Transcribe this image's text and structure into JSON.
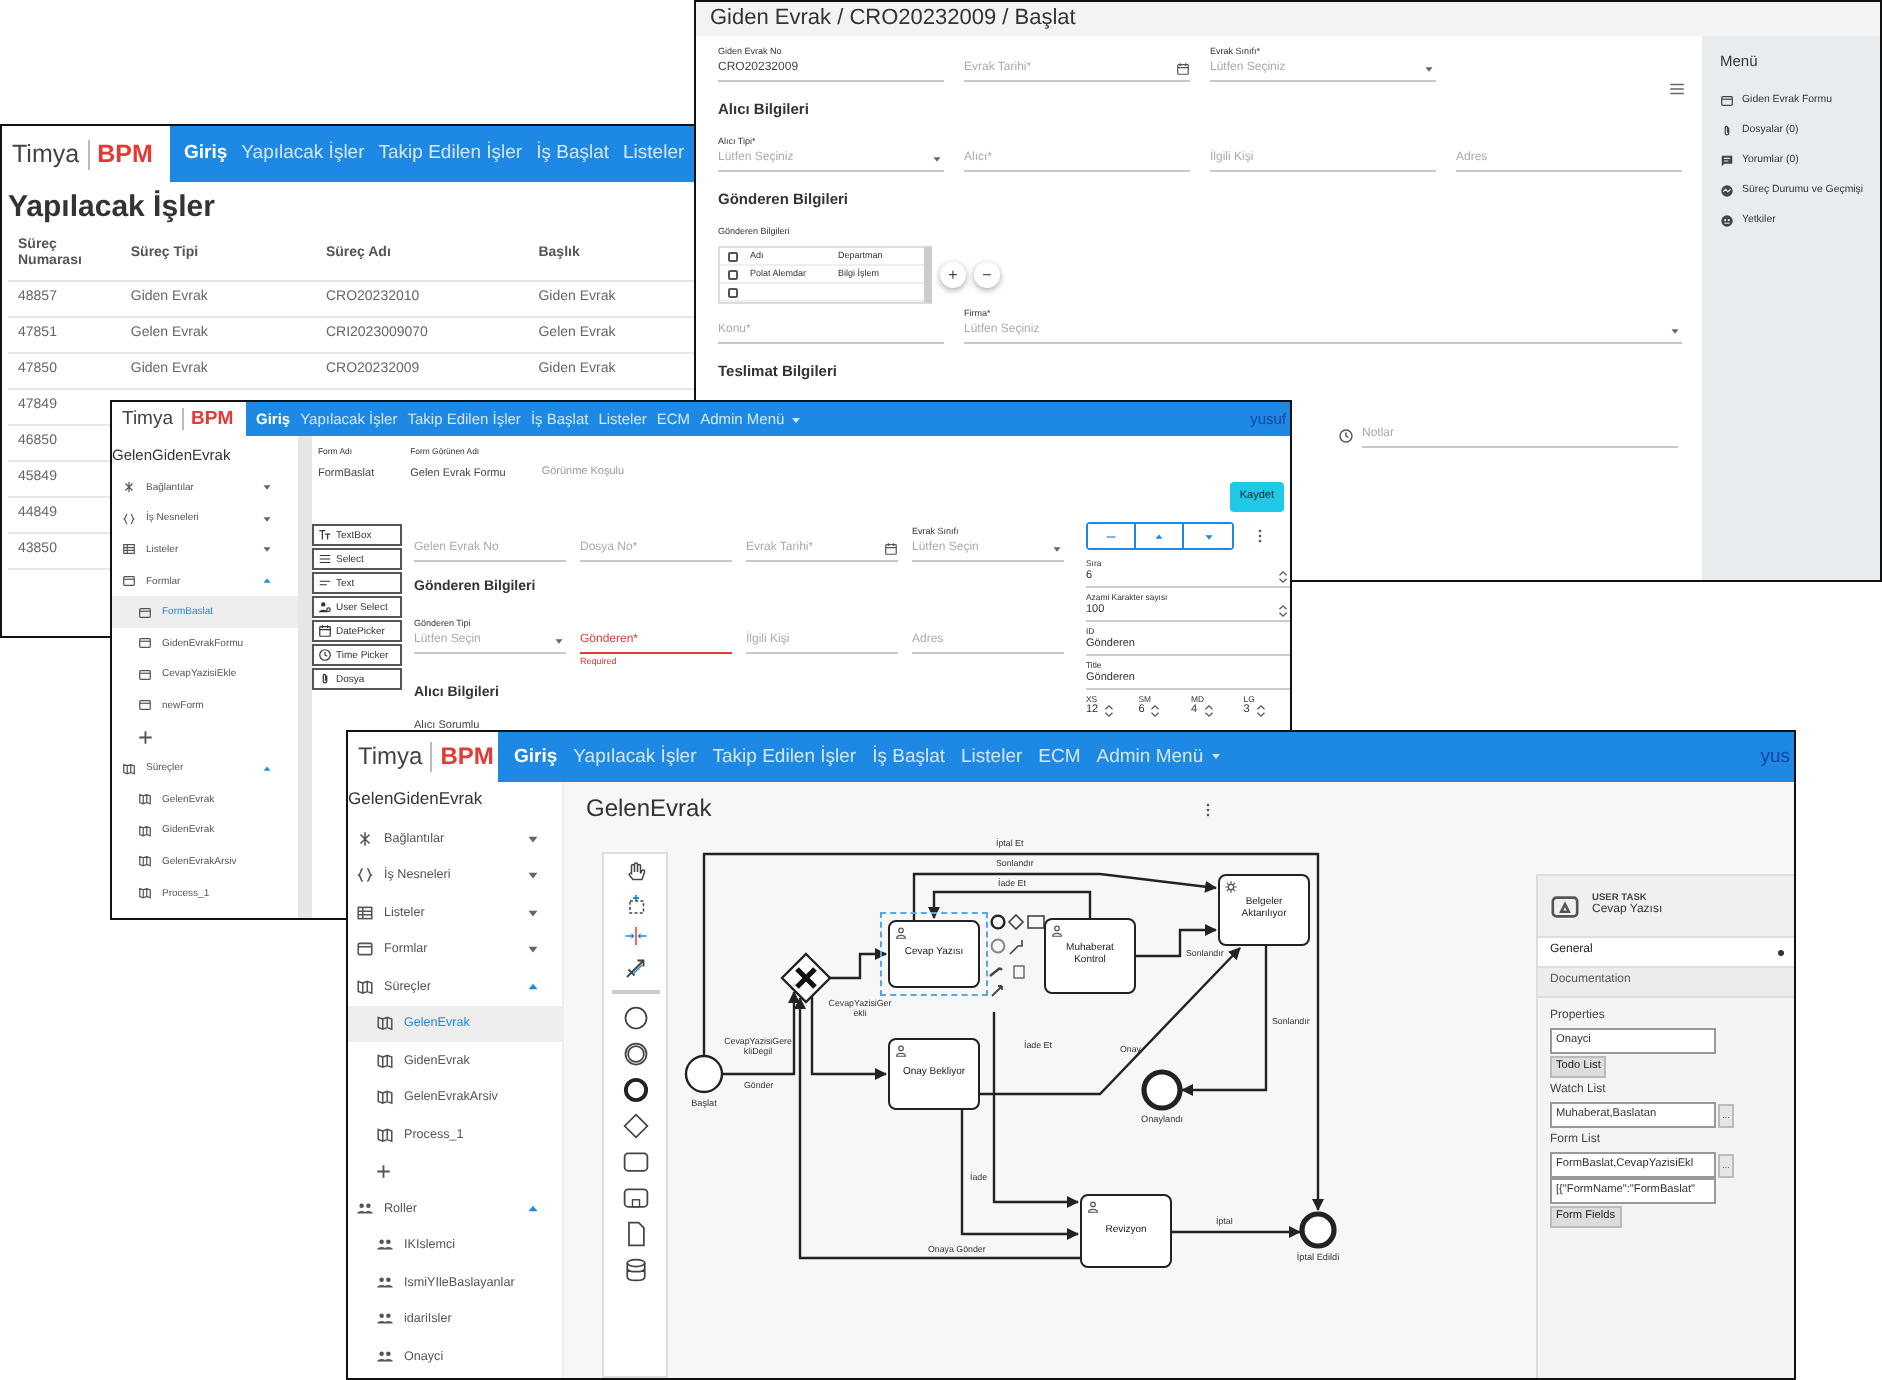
{
  "list_window": {
    "logo": {
      "text": "Timya",
      "accent": "BPM"
    },
    "nav": [
      {
        "label": "Giriş",
        "selected": true
      },
      {
        "label": "Yapılacak İşler",
        "selected": false
      },
      {
        "label": "Takip Edilen İşler",
        "selected": false
      },
      {
        "label": "İş Başlat",
        "selected": false
      },
      {
        "label": "Listeler",
        "selected": false
      }
    ],
    "title": "Yapılacak İşler",
    "columns": [
      "Süreç Numarası",
      "Süreç Tipi",
      "Süreç Adı",
      "Başlık"
    ],
    "rows": [
      [
        "48857",
        "Giden Evrak",
        "CRO20232010",
        "Giden Evrak"
      ],
      [
        "47851",
        "Gelen Evrak",
        "CRI2023009070",
        "Gelen Evrak"
      ],
      [
        "47850",
        "Giden Evrak",
        "CRO20232009",
        "Giden Evrak"
      ],
      [
        "47849"
      ],
      [
        "46850"
      ],
      [
        "45849"
      ],
      [
        "44849"
      ],
      [
        "43850"
      ]
    ]
  },
  "form_window": {
    "title": "Giden Evrak / CRO20232009 / Başlat",
    "blocks": [
      {
        "kind": "fields",
        "fields": [
          {
            "kind": "text",
            "label": "Giden Evrak No",
            "value": "CRO20232009"
          },
          {
            "kind": "date",
            "placeholder": "Evrak Tarihi*"
          },
          {
            "kind": "select",
            "label": "Evrak Sınıfı*",
            "placeholder": "Lütfen Seçiniz"
          }
        ]
      },
      {
        "kind": "heading",
        "text": "Alıcı Bilgileri"
      },
      {
        "kind": "fields",
        "fields": [
          {
            "kind": "select",
            "label": "Alıcı Tipi*",
            "placeholder": "Lütfen Seçiniz"
          },
          {
            "kind": "text",
            "placeholder": "Alıcı*"
          },
          {
            "kind": "text",
            "placeholder": "İlgili Kişi"
          },
          {
            "kind": "text",
            "placeholder": "Adres"
          }
        ]
      },
      {
        "kind": "heading",
        "text": "Gönderen Bilgileri"
      },
      {
        "kind": "grid",
        "label": "Gönderen Bilgileri",
        "header_checked": false,
        "columns": [
          "Adı",
          "Departman"
        ],
        "rows": [
          {
            "cells": [
              "Polat Alemdar",
              "Bilgi İşlem"
            ],
            "checked": false
          },
          {
            "cells": [],
            "checked": false
          }
        ],
        "actions": [
          "+",
          "−"
        ]
      },
      {
        "kind": "fields",
        "fields": [
          {
            "kind": "text",
            "placeholder": "Konu*"
          },
          {
            "kind": "select",
            "label": "Firma*",
            "placeholder": "Lütfen Seçiniz",
            "wide": true
          }
        ]
      },
      {
        "kind": "heading",
        "text": "Teslimat Bilgileri"
      },
      {
        "kind": "trailing_fields",
        "fields": [
          {
            "kind": "note",
            "placeholder": "Notlar"
          }
        ]
      }
    ],
    "menu": {
      "title": "Menü",
      "items": [
        {
          "label": "Giden Evrak Formu",
          "kind": "form"
        },
        {
          "label": "Dosyalar (0)",
          "kind": "files"
        },
        {
          "label": "Yorumlar (0)",
          "kind": "comments"
        },
        {
          "label": "Süreç Durumu ve Geçmişi",
          "kind": "history"
        },
        {
          "label": "Yetkiler",
          "kind": "permissions"
        }
      ]
    }
  },
  "designer_window": {
    "logo": {
      "text": "Timya",
      "accent": "BPM"
    },
    "nav": [
      {
        "label": "Giriş",
        "selected": true,
        "dropdown": false
      },
      {
        "label": "Yapılacak İşler",
        "selected": false,
        "dropdown": false
      },
      {
        "label": "Takip Edilen İşler",
        "selected": false,
        "dropdown": false
      },
      {
        "label": "İş Başlat",
        "selected": false,
        "dropdown": false
      },
      {
        "label": "Listeler",
        "selected": false,
        "dropdown": false
      },
      {
        "label": "ECM",
        "selected": false,
        "dropdown": false
      },
      {
        "label": "Admin Menü",
        "selected": false,
        "dropdown": true
      }
    ],
    "user": "yusuf",
    "sidebar": {
      "title": "GelenGidenEvrak",
      "items": [
        {
          "label": "Bağlantılar",
          "kind": "links",
          "expanded": false
        },
        {
          "label": "İş Nesneleri",
          "kind": "objects",
          "expanded": false
        },
        {
          "label": "Listeler",
          "kind": "lists",
          "expanded": false
        },
        {
          "label": "Formlar",
          "kind": "forms",
          "expanded": true,
          "children": [
            {
              "label": "FormBaslat",
              "kind": "form",
              "selected": true
            },
            {
              "label": "GidenEvrakFormu",
              "kind": "form",
              "selected": false
            },
            {
              "label": "CevapYazisiEkle",
              "kind": "form",
              "selected": false
            },
            {
              "label": "newForm",
              "kind": "form",
              "selected": false
            },
            {
              "label": "+",
              "kind": "add"
            }
          ]
        },
        {
          "label": "Süreçler",
          "kind": "processes",
          "expanded": true,
          "children": [
            {
              "label": "GelenEvrak",
              "kind": "process",
              "selected": false
            },
            {
              "label": "GidenEvrak",
              "kind": "process",
              "selected": false
            },
            {
              "label": "GelenEvrakArsiv",
              "kind": "process",
              "selected": false
            },
            {
              "label": "Process_1",
              "kind": "process",
              "selected": false
            }
          ]
        }
      ]
    },
    "form_header": [
      {
        "label": "Form Adı",
        "value": "FormBaslat"
      },
      {
        "label": "Form Görünen Adı",
        "value": "Gelen Evrak Formu"
      },
      {
        "placeholder": "Görünme Koşulu"
      }
    ],
    "save_button": "Kaydet",
    "palette": [
      {
        "label": "TextBox",
        "kind": "textbox"
      },
      {
        "label": "Select",
        "kind": "select"
      },
      {
        "label": "Text",
        "kind": "text"
      },
      {
        "label": "User Select",
        "kind": "user"
      },
      {
        "label": "DatePicker",
        "kind": "date"
      },
      {
        "label": "Time Picker",
        "kind": "time"
      },
      {
        "label": "Dosya",
        "kind": "file"
      }
    ],
    "blocks": [
      {
        "kind": "fields",
        "fields": [
          {
            "kind": "text",
            "placeholder": "Gelen Evrak No"
          },
          {
            "kind": "text",
            "placeholder": "Dosya No*"
          },
          {
            "kind": "date",
            "placeholder": "Evrak Tarihi*"
          },
          {
            "kind": "select",
            "label": "Evrak Sınıfı",
            "placeholder": "Lütfen Seçin"
          }
        ]
      },
      {
        "kind": "heading",
        "text": "Gönderen Bilgileri"
      },
      {
        "kind": "fields",
        "fields": [
          {
            "kind": "select",
            "label": "Gönderen Tipi",
            "placeholder": "Lütfen Seçin"
          },
          {
            "kind": "text",
            "placeholder": "Gönderen*",
            "error": "Required"
          },
          {
            "kind": "text",
            "placeholder": "İlgili Kişi"
          },
          {
            "kind": "text",
            "placeholder": "Adres"
          }
        ]
      },
      {
        "kind": "heading",
        "text": "Alıcı Bilgileri"
      },
      {
        "kind": "caption",
        "text": "Alıcı Sorumlu"
      }
    ],
    "properties": [
      {
        "label": "Sıra",
        "value": "6",
        "kind": "number"
      },
      {
        "label": "Azami Karakter sayısı",
        "value": "100",
        "kind": "number"
      },
      {
        "label": "ID",
        "value": "Gönderen",
        "kind": "text"
      },
      {
        "label": "Title",
        "value": "Gönderen",
        "kind": "text"
      }
    ],
    "sizes": [
      {
        "label": "XS",
        "value": "12"
      },
      {
        "label": "SM",
        "value": "6"
      },
      {
        "label": "MD",
        "value": "4"
      },
      {
        "label": "LG",
        "value": "3"
      }
    ]
  },
  "process_window": {
    "logo": {
      "text": "Timya",
      "accent": "BPM"
    },
    "nav": [
      {
        "label": "Giriş",
        "selected": true,
        "dropdown": false
      },
      {
        "label": "Yapılacak İşler",
        "selected": false,
        "dropdown": false
      },
      {
        "label": "Takip Edilen İşler",
        "selected": false,
        "dropdown": false
      },
      {
        "label": "İş Başlat",
        "selected": false,
        "dropdown": false
      },
      {
        "label": "Listeler",
        "selected": false,
        "dropdown": false
      },
      {
        "label": "ECM",
        "selected": false,
        "dropdown": false
      },
      {
        "label": "Admin Menü",
        "selected": false,
        "dropdown": true
      }
    ],
    "user": "yus",
    "sidebar": {
      "title": "GelenGidenEvrak",
      "items": [
        {
          "label": "Bağlantılar",
          "kind": "links",
          "expanded": false
        },
        {
          "label": "İş Nesneleri",
          "kind": "objects",
          "expanded": false
        },
        {
          "label": "Listeler",
          "kind": "lists",
          "expanded": false
        },
        {
          "label": "Formlar",
          "kind": "forms",
          "expanded": false
        },
        {
          "label": "Süreçler",
          "kind": "processes",
          "expanded": true,
          "children": [
            {
              "label": "GelenEvrak",
              "kind": "process",
              "selected": true
            },
            {
              "label": "GidenEvrak",
              "kind": "process",
              "selected": false
            },
            {
              "label": "GelenEvrakArsiv",
              "kind": "process",
              "selected": false
            },
            {
              "label": "Process_1",
              "kind": "process",
              "selected": false
            },
            {
              "label": "+",
              "kind": "add"
            }
          ]
        },
        {
          "label": "Roller",
          "kind": "roles",
          "expanded": true,
          "children": [
            {
              "label": "IKIslemci",
              "kind": "role",
              "selected": false
            },
            {
              "label": "IsmiYIleBaslayanlar",
              "kind": "role",
              "selected": false
            },
            {
              "label": "idariIsler",
              "kind": "role",
              "selected": false
            },
            {
              "label": "Onayci",
              "kind": "role",
              "selected": false
            }
          ]
        }
      ]
    },
    "title": "GelenEvrak",
    "diagram": {
      "nodes": [
        {
          "kind": "start",
          "label": "Başlat"
        },
        {
          "kind": "gateway"
        },
        {
          "kind": "user_task",
          "label": "Cevap Yazısı",
          "selected": true
        },
        {
          "kind": "user_task",
          "label": "Muhaberat Kontrol",
          "selected": false
        },
        {
          "kind": "service_task",
          "label": "Belgeler Aktarılıyor",
          "selected": false
        },
        {
          "kind": "user_task",
          "label": "Onay Bekliyor",
          "selected": false
        },
        {
          "kind": "end",
          "label": "Onaylandı"
        },
        {
          "kind": "user_task",
          "label": "Revizyon",
          "selected": false
        },
        {
          "kind": "end",
          "label": "İptal Edildi"
        }
      ],
      "edges": [
        {
          "label": "İptal Et"
        },
        {
          "label": "Sonlandır"
        },
        {
          "label": "İade Et"
        },
        {
          "label": "CevapYazisiGerekli"
        },
        {
          "label": "Gönder"
        },
        {
          "label": "CevapYazisiGerekliDegil"
        },
        {
          "label": "Sonlandır"
        },
        {
          "label": "İade Et"
        },
        {
          "label": "Onay"
        },
        {
          "label": "Sonlandır"
        },
        {
          "label": "İade"
        },
        {
          "label": "İptal"
        },
        {
          "label": "Onaya Gönder"
        }
      ]
    },
    "panel": {
      "type": "USER TASK",
      "name": "Cevap Yazısı",
      "tabs": [
        {
          "label": "General",
          "selected": true
        },
        {
          "label": "Documentation",
          "selected": false
        }
      ],
      "section": "Properties",
      "items": [
        {
          "kind": "input",
          "value": "Onayci"
        },
        {
          "kind": "button",
          "label": "Todo List"
        },
        {
          "kind": "label",
          "text": "Watch List"
        },
        {
          "kind": "picker",
          "value": "Muhaberat,Baslatan",
          "action": "..."
        },
        {
          "kind": "label",
          "text": "Form List"
        },
        {
          "kind": "picker",
          "value": "FormBaslat,CevapYazisiEkl",
          "action": "..."
        },
        {
          "kind": "input",
          "value": "[{\"FormName\":\"FormBaslat\""
        },
        {
          "kind": "button",
          "label": "Form Fields"
        }
      ]
    }
  }
}
